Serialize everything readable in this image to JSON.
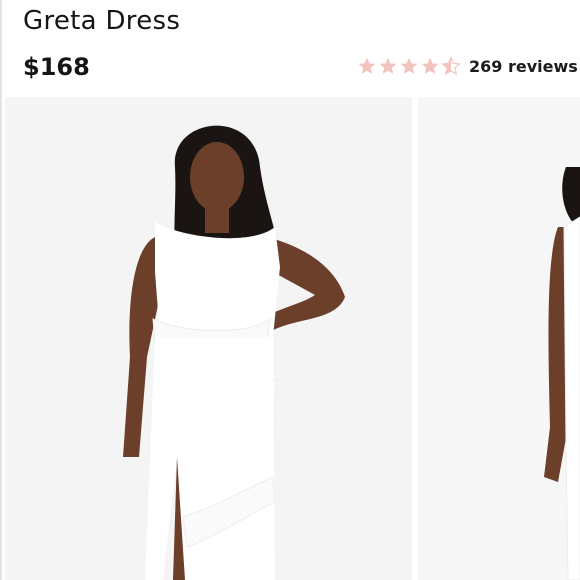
{
  "product": {
    "title": "Greta Dress",
    "price": "$168",
    "rating_value": 4.5,
    "rating_max": 5,
    "reviews_text": "269 reviews"
  },
  "colors": {
    "star": "#f2c4bd",
    "photo_bg": "#f4f4f4",
    "dress": "#ffffff",
    "skin": "#6b3f2a",
    "hair": "#1a1413"
  },
  "gallery": {
    "images": [
      {
        "name": "product-photo-front",
        "content": "model-front"
      },
      {
        "name": "product-photo-side",
        "content": "model-side"
      }
    ]
  }
}
